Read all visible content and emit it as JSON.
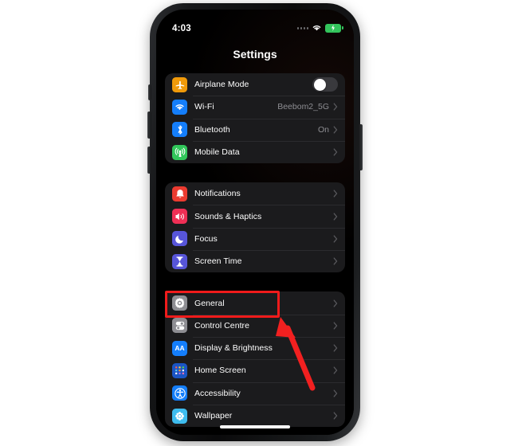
{
  "device": {
    "frame_color": "#1b1d1f",
    "screen_bg": "#000000"
  },
  "status_bar": {
    "time": "4:03",
    "wifi_icon": "wifi-icon",
    "signal_icon": "signal-dots-icon",
    "battery_icon": "battery-charging-icon",
    "battery_color": "#33c45c"
  },
  "nav": {
    "title": "Settings"
  },
  "groups": [
    {
      "id": "connectivity",
      "rows": [
        {
          "label": "Airplane Mode",
          "icon": "airplane-icon",
          "icon_color": "#f09a0a",
          "control": "toggle",
          "toggle_on": false,
          "value": "",
          "chevron": false
        },
        {
          "label": "Wi-Fi",
          "icon": "wifi-icon",
          "icon_color": "#147efb",
          "control": "value",
          "value": "Beebom2_5G",
          "chevron": true
        },
        {
          "label": "Bluetooth",
          "icon": "bluetooth-icon",
          "icon_color": "#147efb",
          "control": "value",
          "value": "On",
          "chevron": true
        },
        {
          "label": "Mobile Data",
          "icon": "cellular-antenna-icon",
          "icon_color": "#31c65a",
          "control": "value",
          "value": "",
          "chevron": true
        }
      ]
    },
    {
      "id": "alerts",
      "rows": [
        {
          "label": "Notifications",
          "icon": "bell-icon",
          "icon_color": "#eb3b30",
          "control": "value",
          "value": "",
          "chevron": true
        },
        {
          "label": "Sounds & Haptics",
          "icon": "speaker-waves-icon",
          "icon_color": "#ef2f55",
          "control": "value",
          "value": "",
          "chevron": true
        },
        {
          "label": "Focus",
          "icon": "crescent-moon-icon",
          "icon_color": "#5755d9",
          "control": "value",
          "value": "",
          "chevron": true
        },
        {
          "label": "Screen Time",
          "icon": "hourglass-icon",
          "icon_color": "#5755d9",
          "control": "value",
          "value": "",
          "chevron": true
        }
      ]
    },
    {
      "id": "system",
      "rows": [
        {
          "label": "General",
          "icon": "gear-icon",
          "icon_color": "#8e8e93",
          "control": "value",
          "value": "",
          "chevron": true
        },
        {
          "label": "Control Centre",
          "icon": "control-toggles-icon",
          "icon_color": "#8e8e93",
          "control": "value",
          "value": "",
          "chevron": true
        },
        {
          "label": "Display & Brightness",
          "icon": "text-size-aa-icon",
          "icon_color": "#147efb",
          "control": "value",
          "value": "",
          "chevron": true
        },
        {
          "label": "Home Screen",
          "icon": "app-grid-icon",
          "icon_color": "#1b55c4",
          "control": "value",
          "value": "",
          "chevron": true
        },
        {
          "label": "Accessibility",
          "icon": "accessibility-person-icon",
          "icon_color": "#147efb",
          "control": "value",
          "value": "",
          "chevron": true
        },
        {
          "label": "Wallpaper",
          "icon": "flower-wallpaper-icon",
          "icon_color": "#3ebcee",
          "control": "value",
          "value": "",
          "chevron": true
        }
      ]
    }
  ],
  "annotations": {
    "highlight_color": "#f01b1b",
    "highlight_target": "General",
    "arrow_color": "#f22020",
    "arrow_points_to": "General"
  }
}
